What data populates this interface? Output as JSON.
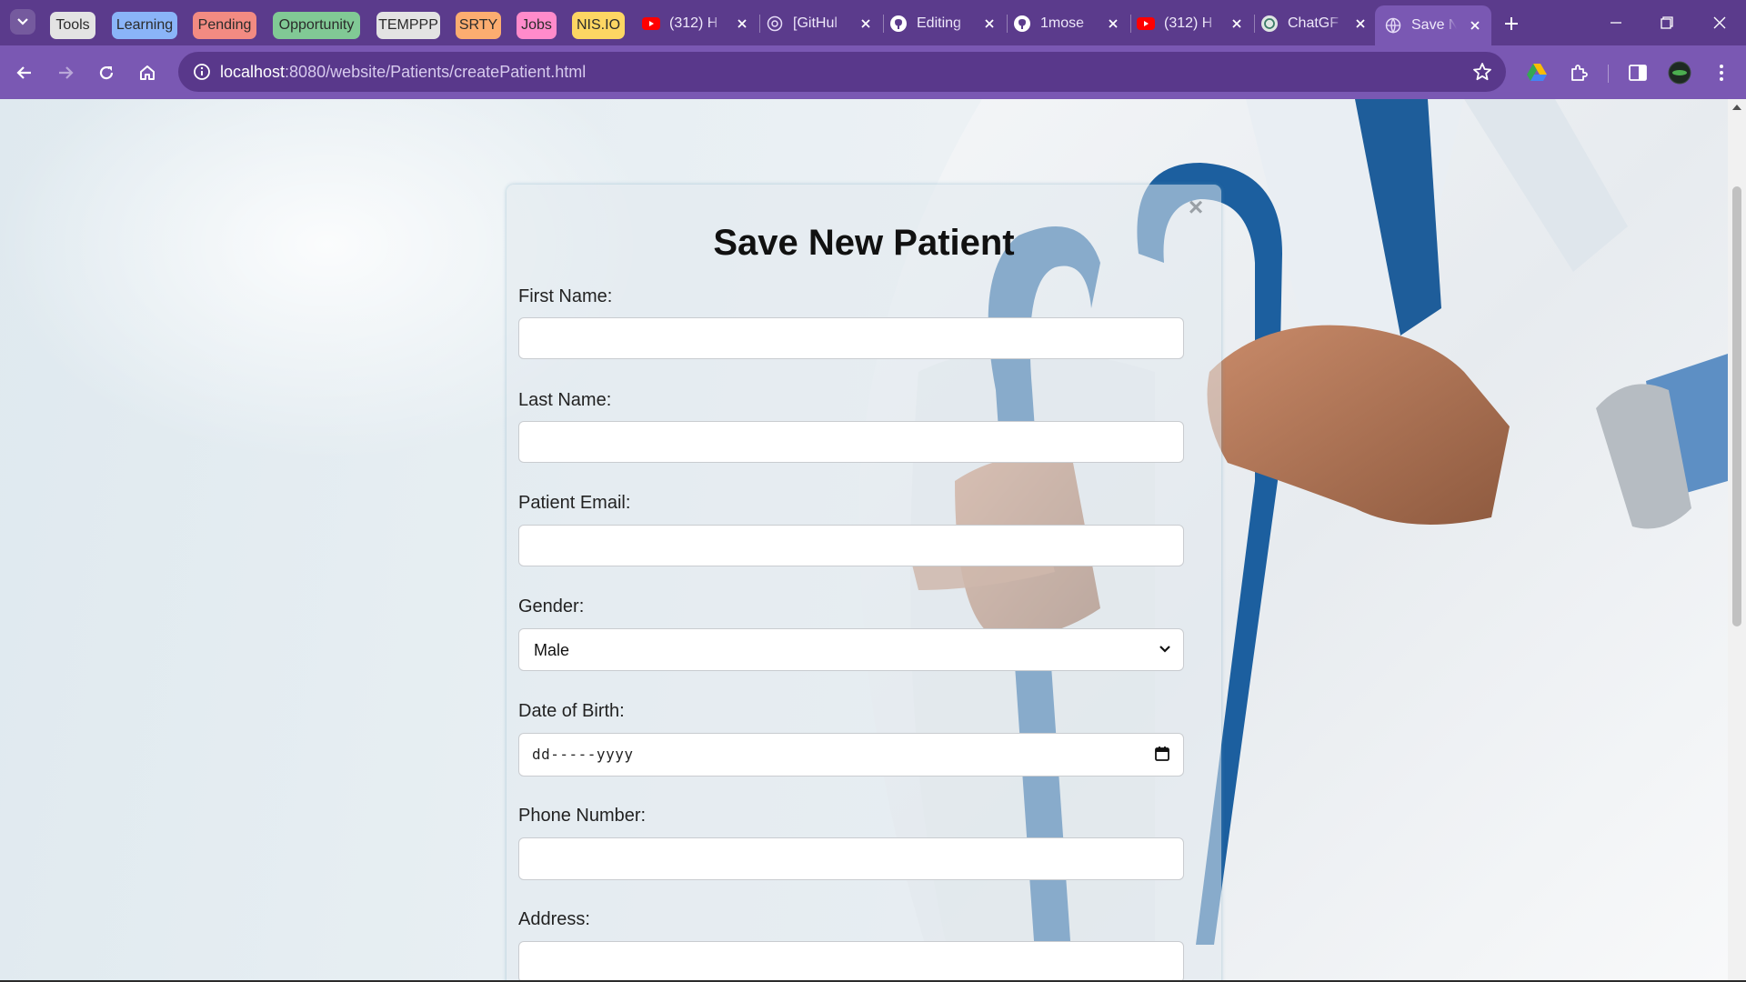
{
  "browser": {
    "tab_groups": [
      {
        "label": "Tools",
        "color": "#e3e3e3"
      },
      {
        "label": "Learning",
        "color": "#8ab4f8"
      },
      {
        "label": "Pending",
        "color": "#f28b82"
      },
      {
        "label": "Opportunity",
        "color": "#81c995"
      },
      {
        "label": "TEMPPP",
        "color": "#e3e3e3"
      },
      {
        "label": "SRTY",
        "color": "#fcad70"
      },
      {
        "label": "Jobs",
        "color": "#ff8bcb"
      },
      {
        "label": "NIS.IO",
        "color": "#fdd663"
      }
    ],
    "tabs": [
      {
        "title": "(312) H",
        "icon": "youtube-icon"
      },
      {
        "title": "[GitHul",
        "icon": "globe-icon"
      },
      {
        "title": "Editing",
        "icon": "github-icon"
      },
      {
        "title": "1mose",
        "icon": "github-icon"
      },
      {
        "title": "(312) H",
        "icon": "youtube-icon"
      },
      {
        "title": "ChatGF",
        "icon": "chatgpt-icon"
      },
      {
        "title": "Save N",
        "icon": "globe-icon",
        "active": true
      }
    ],
    "url_host": "localhost",
    "url_path": ":8080/website/Patients/createPatient.html",
    "accent": "#7a58b3"
  },
  "form": {
    "title": "Save New Patient",
    "close_symbol": "×",
    "first_name_label": "First Name:",
    "last_name_label": "Last Name:",
    "email_label": "Patient Email:",
    "gender_label": "Gender:",
    "gender_value": "Male",
    "dob_label": "Date of Birth:",
    "dob_placeholder": "dd-----yyyy",
    "phone_label": "Phone Number:",
    "address_label": "Address:"
  }
}
